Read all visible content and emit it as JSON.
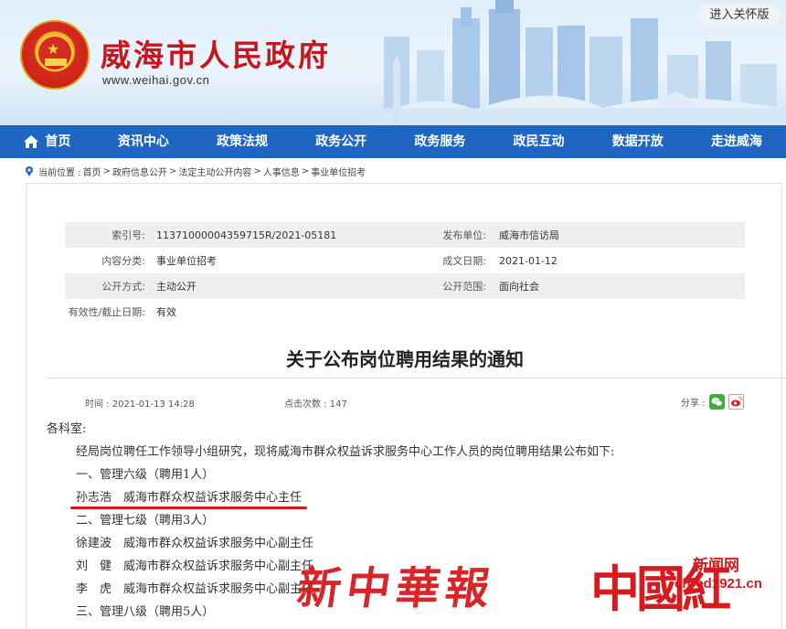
{
  "header": {
    "site_title": "威海市人民政府",
    "site_url": "www.weihai.gov.cn",
    "care_mode": "进入关怀版"
  },
  "nav": {
    "items": [
      "首页",
      "资讯中心",
      "政策法规",
      "政务公开",
      "政务服务",
      "政民互动",
      "数据开放",
      "走进威海"
    ]
  },
  "breadcrumb": {
    "prefix": "当前位置 :",
    "items": [
      "首页",
      "政府信息公开",
      "法定主动公开内容",
      "人事信息",
      "事业单位招考"
    ],
    "separator": ">"
  },
  "meta": {
    "index_label": "索引号:",
    "index_value": "11371000004359715R/2021-05181",
    "publisher_label": "发布单位:",
    "publisher_value": "威海市信访局",
    "category_label": "内容分类:",
    "category_value": "事业单位招考",
    "date_label": "成文日期:",
    "date_value": "2021-01-12",
    "mode_label": "公开方式:",
    "mode_value": "主动公开",
    "scope_label": "公开范围:",
    "scope_value": "面向社会",
    "validity_label": "有效性/截止日期:",
    "validity_value": "有效"
  },
  "article": {
    "title": "关于公布岗位聘用结果的通知",
    "time_label": "时间 :",
    "time_value": "2021-01-13 14:28",
    "clicks_label": "点击次数 :",
    "clicks_value": "147",
    "share_label": "分享 :",
    "paragraphs": [
      "各科室:",
      "经局岗位聘任工作领导小组研究，现将威海市群众权益诉求服务中心工作人员的岗位聘用结果公布如下:",
      "一、管理六级（聘用1人）",
      "孙志浩　威海市群众权益诉求服务中心主任",
      "二、管理七级（聘用3人）",
      "徐建波　威海市群众权益诉求服务中心副主任",
      "刘　健　威海市群众权益诉求服务中心副主任",
      "李　虎　威海市群众权益诉求服务中心副主任",
      "三、管理八级（聘用5人）"
    ]
  },
  "watermark": {
    "brand1": "新中華報",
    "brand2": "中國紅",
    "brand2_sub1": "新闻网",
    "brand2_sub2": "cnred1921.cn"
  },
  "icons": {
    "home": "home-icon",
    "location": "location-icon",
    "wechat": "wechat-icon",
    "weibo": "weibo-icon"
  },
  "colors": {
    "nav_blue": "#1f66c1",
    "title_red": "#c8161d",
    "wechat_green": "#3cb034",
    "weibo_red": "#e6162d"
  }
}
